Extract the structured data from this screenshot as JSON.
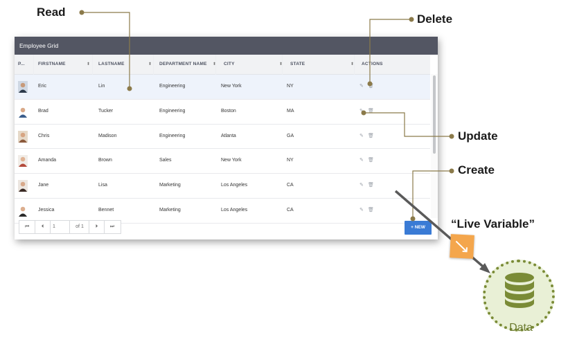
{
  "grid": {
    "title": "Employee Grid",
    "columns": [
      "P...",
      "FIRSTNAME",
      "LASTNAME",
      "DEPARTMENT NAME",
      "CITY",
      "STATE",
      "ACTIONS"
    ],
    "rows": [
      {
        "first": "Eric",
        "last": "Lin",
        "dept": "Engineering",
        "city": "New York",
        "state": "NY"
      },
      {
        "first": "Brad",
        "last": "Tucker",
        "dept": "Engineering",
        "city": "Boston",
        "state": "MA"
      },
      {
        "first": "Chris",
        "last": "Madison",
        "dept": "Engineering",
        "city": "Atlanta",
        "state": "GA"
      },
      {
        "first": "Amanda",
        "last": "Brown",
        "dept": "Sales",
        "city": "New York",
        "state": "NY"
      },
      {
        "first": "Jane",
        "last": "Lisa",
        "dept": "Marketing",
        "city": "Los Angeles",
        "state": "CA"
      },
      {
        "first": "Jessica",
        "last": "Bennet",
        "dept": "Marketing",
        "city": "Los Angeles",
        "state": "CA"
      }
    ],
    "pager": {
      "page": "1",
      "of": "of 1"
    },
    "new_button": "NEW",
    "new_icon": "+"
  },
  "callouts": {
    "read": "Read",
    "delete": "Delete",
    "update": "Update",
    "create": "Create",
    "live_variable": "“Live Variable”"
  },
  "data_store": {
    "label": "Data"
  },
  "colors": {
    "title_bar": "#535663",
    "accent": "#3a7bd5",
    "callout_line": "#8b7a4a",
    "data_circle_fill": "#e9f0d6",
    "data_circle_border": "#7a8b36",
    "live_variable_icon": "#f4a64c"
  }
}
